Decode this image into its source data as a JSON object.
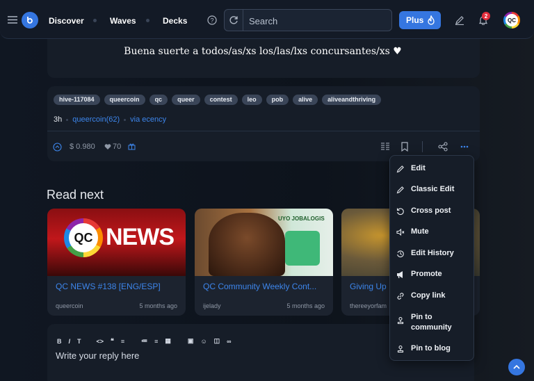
{
  "header": {
    "nav": {
      "discover": "Discover",
      "waves": "Waves",
      "decks": "Decks"
    },
    "search_placeholder": "Search",
    "plus_label": "Plus",
    "notification_count": "2",
    "avatar_initials": "QC"
  },
  "post": {
    "text": "Buena suerte a todos/as/xs los/las/lxs concursantes/xs ♥"
  },
  "tags": [
    "hive-117084",
    "queercoin",
    "qc",
    "queer",
    "contest",
    "leo",
    "pob",
    "alive",
    "aliveandthriving"
  ],
  "meta": {
    "age": "3h",
    "author": "queercoin(62)",
    "via": "via ecency"
  },
  "stats": {
    "payout": "$ 0.980",
    "votes": "70"
  },
  "read_next": {
    "title": "Read next",
    "items": [
      {
        "title": "QC NEWS #138 [ENG/ESP]",
        "author": "queercoin",
        "time": "5 months ago",
        "thumb_text": "NEWS",
        "thumb_logo": "QC"
      },
      {
        "title": "QC Community Weekly Cont...",
        "author": "ijelady",
        "time": "5 months ago",
        "thumb_text": "UYO JOBALOGIS"
      },
      {
        "title": "Giving Up",
        "author": "thereeyorfam",
        "time": ""
      }
    ]
  },
  "editor": {
    "placeholder": "Write your reply here"
  },
  "menu": {
    "items": [
      {
        "label": "Edit",
        "icon": "pencil-icon"
      },
      {
        "label": "Classic Edit",
        "icon": "pencil-icon"
      },
      {
        "label": "Cross post",
        "icon": "cross-post-icon"
      },
      {
        "label": "Mute",
        "icon": "mute-icon"
      },
      {
        "label": "Edit History",
        "icon": "history-icon"
      },
      {
        "label": "Promote",
        "icon": "megaphone-icon"
      },
      {
        "label": "Copy link",
        "icon": "link-icon"
      },
      {
        "label": "Pin to community",
        "icon": "pin-icon"
      },
      {
        "label": "Pin to blog",
        "icon": "pin-icon"
      }
    ]
  },
  "colors": {
    "accent": "#3576e0",
    "link": "#3d86ec",
    "background": "#0d131c",
    "card": "#161d28",
    "badge": "#e22d3c"
  }
}
